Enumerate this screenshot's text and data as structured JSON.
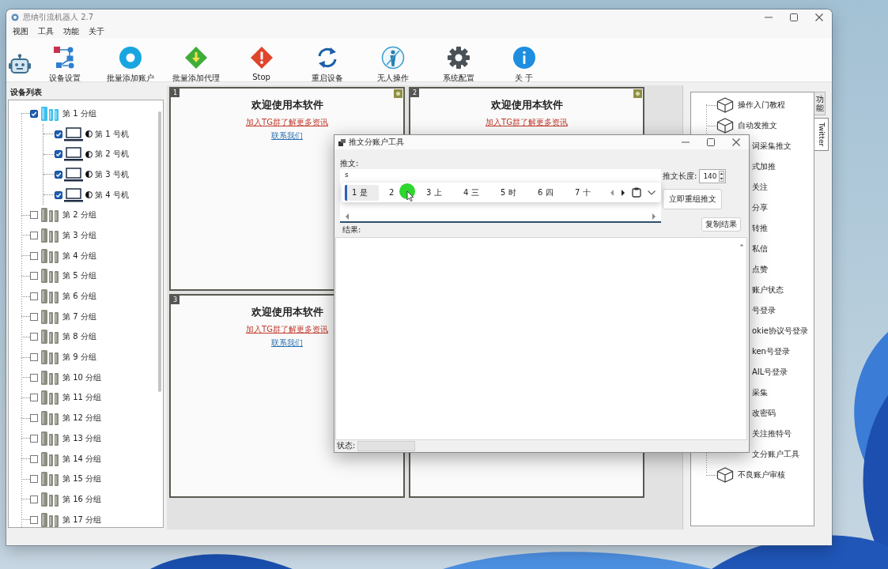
{
  "window": {
    "title": "思纳引流机器人 2.7"
  },
  "menu": [
    "视图",
    "工具",
    "功能",
    "关于"
  ],
  "toolbar": [
    "设备设置",
    "批量添加账户",
    "批量添加代理",
    "Stop",
    "重启设备",
    "无人操作",
    "系统配置",
    "关 于"
  ],
  "device_list": {
    "title": "设备列表",
    "groups": [
      {
        "label": "第 1 分组",
        "checked": true,
        "selected": true,
        "children": [
          {
            "label": "第 1 号机",
            "checked": true
          },
          {
            "label": "第 2 号机",
            "checked": true
          },
          {
            "label": "第 3 号机",
            "checked": true
          },
          {
            "label": "第 4 号机",
            "checked": true
          }
        ]
      },
      {
        "label": "第 2 分组",
        "checked": false,
        "selected": false
      },
      {
        "label": "第 3 分组",
        "checked": false,
        "selected": false
      },
      {
        "label": "第 4 分组",
        "checked": false,
        "selected": false
      },
      {
        "label": "第 5 分组",
        "checked": false,
        "selected": false
      },
      {
        "label": "第 6 分组",
        "checked": false,
        "selected": false
      },
      {
        "label": "第 7 分组",
        "checked": false,
        "selected": false
      },
      {
        "label": "第 8 分组",
        "checked": false,
        "selected": false
      },
      {
        "label": "第 9 分组",
        "checked": false,
        "selected": false
      },
      {
        "label": "第 10 分组",
        "checked": false,
        "selected": false
      },
      {
        "label": "第 11 分组",
        "checked": false,
        "selected": false
      },
      {
        "label": "第 12 分组",
        "checked": false,
        "selected": false
      },
      {
        "label": "第 13 分组",
        "checked": false,
        "selected": false
      },
      {
        "label": "第 14 分组",
        "checked": false,
        "selected": false
      },
      {
        "label": "第 15 分组",
        "checked": false,
        "selected": false
      },
      {
        "label": "第 16 分组",
        "checked": false,
        "selected": false
      },
      {
        "label": "第 17 分组",
        "checked": false,
        "selected": false
      }
    ]
  },
  "screens": [
    {
      "kind": "welcome",
      "number": "1",
      "status_badge": true,
      "title": "欢迎使用本软件",
      "notice": "加入TG群了解更多资讯",
      "link": "联系我们"
    },
    {
      "kind": "welcome",
      "number": "2",
      "status_badge": true,
      "title": "欢迎使用本软件",
      "notice": "加入TG群了解更多资讯"
    },
    {
      "kind": "welcome",
      "number": "3",
      "title": "欢迎使用本软件",
      "notice": "加入TG群了解更多资讯",
      "link": "联系我们"
    },
    {
      "kind": "blank"
    }
  ],
  "function_panel": {
    "tabs": [
      {
        "label": "功能",
        "selected": false
      },
      {
        "label": "Twitter",
        "selected": true
      }
    ],
    "items": [
      {
        "kind": "full",
        "label": "操作入门教程"
      },
      {
        "kind": "full",
        "label": "自动发推文"
      },
      {
        "kind": "clipped",
        "label": "词采集推文"
      },
      {
        "kind": "clipped",
        "label": "式加推"
      },
      {
        "kind": "clipped",
        "label": "关注"
      },
      {
        "kind": "clipped",
        "label": "分享"
      },
      {
        "kind": "clipped",
        "label": "转推"
      },
      {
        "kind": "clipped",
        "label": "私信"
      },
      {
        "kind": "clipped",
        "label": "点赞"
      },
      {
        "kind": "clipped",
        "label": "账户状态"
      },
      {
        "kind": "clipped",
        "label": "号登录"
      },
      {
        "kind": "clipped",
        "label": "okie协议号登录"
      },
      {
        "kind": "clipped",
        "label": "ken号登录"
      },
      {
        "kind": "clipped",
        "label": "AIL号登录"
      },
      {
        "kind": "clipped",
        "label": "采集"
      },
      {
        "kind": "clipped",
        "label": "改密码"
      },
      {
        "kind": "clipped",
        "label": "关注推特号"
      },
      {
        "kind": "clipped",
        "label": "文分账户工具"
      },
      {
        "kind": "full",
        "label": "不良账户审核"
      }
    ]
  },
  "dialog": {
    "title": "推文分账户工具",
    "tweet_label": "推文:",
    "tweet_text": "s",
    "ime_candidates": [
      {
        "label": "1 是",
        "selected": true
      },
      {
        "label": "2",
        "selected": false
      },
      {
        "label": "3 上",
        "selected": false
      },
      {
        "label": "4 三",
        "selected": false
      },
      {
        "label": "5 时",
        "selected": false
      },
      {
        "label": "6 四",
        "selected": false
      },
      {
        "label": "7 十",
        "selected": false
      }
    ],
    "length_label": "推文长度:",
    "length_value": "140",
    "regroup_button": "立即重组推文",
    "result_label": "结果:",
    "copy_button": "复制结果",
    "status_label": "状态:"
  }
}
